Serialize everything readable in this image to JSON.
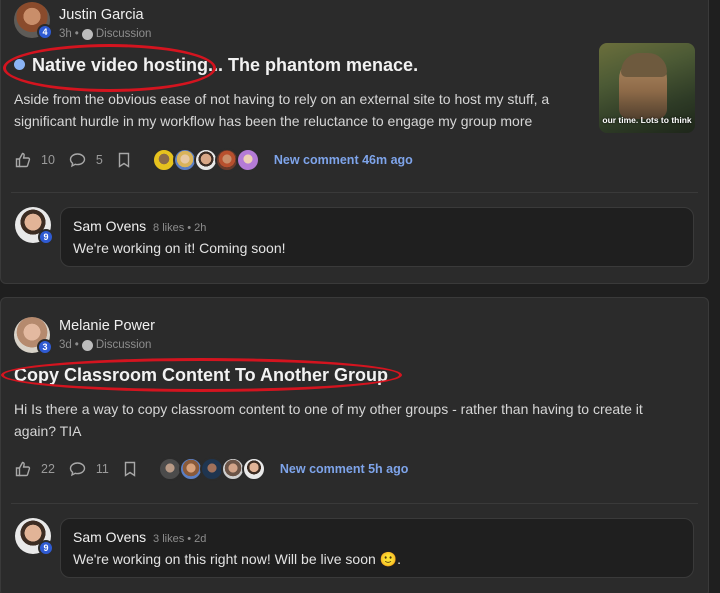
{
  "posts": [
    {
      "author": "Justin Garcia",
      "level": "4",
      "time": "3h",
      "category": "Discussion",
      "title": "Native video hosting... The phantom menace.",
      "body_line1": "Aside from the obvious ease of not having to rely on an external site to host my stuff, a",
      "body_line2": "significant hurdle in my workflow has been the reluctance to engage my group more",
      "likes": "10",
      "comments": "5",
      "new_comment": "New comment 46m ago",
      "thumbnail_caption": "our time. Lots to think",
      "comment": {
        "author": "Sam Ovens",
        "level": "9",
        "meta": "8 likes • 2h",
        "text": "We're working on it! Coming soon!"
      }
    },
    {
      "author": "Melanie Power",
      "level": "3",
      "time": "3d",
      "category": "Discussion",
      "title": "Copy Classroom Content To Another Group",
      "body_line1": "Hi Is there a way to copy classroom content to one of my other groups - rather than having to create it",
      "body_line2": "again? TIA",
      "likes": "22",
      "comments": "11",
      "new_comment": "New comment 5h ago",
      "comment": {
        "author": "Sam Ovens",
        "level": "9",
        "meta": "3 likes • 2d",
        "text": "We're working on this right now! Will be live soon 🙂."
      }
    }
  ],
  "colors": {
    "card_bg": "#2b2b2b",
    "link": "#7ea4ea",
    "highlight_oval": "#d4141f",
    "level_badge": "#2f5bd3"
  }
}
